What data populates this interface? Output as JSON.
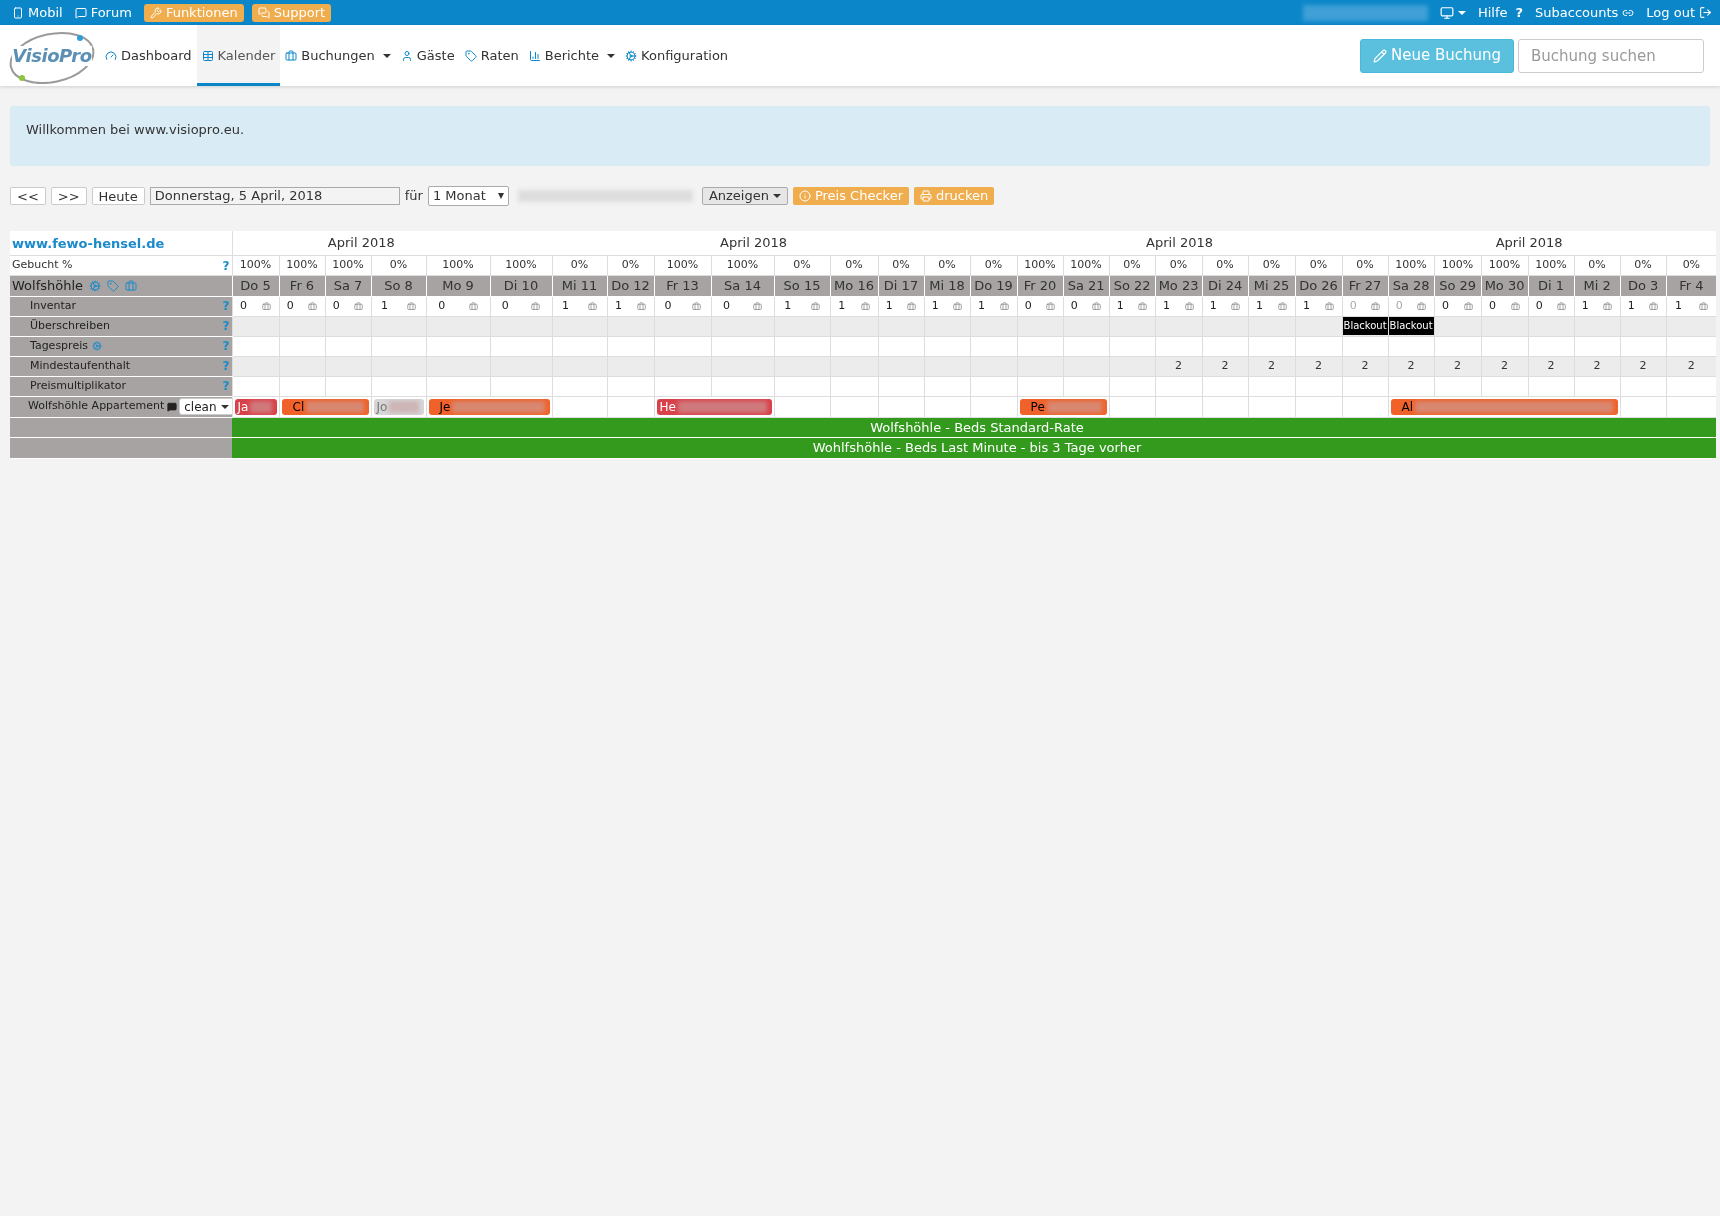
{
  "top_bar": {
    "left": [
      {
        "label": "Mobil",
        "kind": "link"
      },
      {
        "label": "Forum",
        "kind": "link"
      },
      {
        "label": "Funktionen",
        "kind": "button"
      },
      {
        "label": "Support",
        "kind": "button"
      }
    ],
    "right": [
      {
        "label": "Hilfe",
        "glyph": "?"
      },
      {
        "label": "Subaccounts"
      },
      {
        "label": "Log out"
      }
    ]
  },
  "nav": {
    "logo": "VisioPro",
    "items": [
      {
        "label": "Dashboard",
        "selected": false,
        "dropdown": false
      },
      {
        "label": "Kalender",
        "selected": true,
        "dropdown": false
      },
      {
        "label": "Buchungen",
        "selected": false,
        "dropdown": true
      },
      {
        "label": "Gäste",
        "selected": false,
        "dropdown": false
      },
      {
        "label": "Raten",
        "selected": false,
        "dropdown": false
      },
      {
        "label": "Berichte",
        "selected": false,
        "dropdown": true
      },
      {
        "label": "Konfiguration",
        "selected": false,
        "dropdown": false
      }
    ],
    "new_booking": "Neue Buchung",
    "search": {
      "placeholder": "Buchung suchen"
    }
  },
  "welcome": "Willkommen bei www.visiopro.eu.",
  "toolbar": {
    "prev": "<<",
    "next": ">>",
    "today": "Heute",
    "date": "Donnerstag, 5 April, 2018",
    "for_label": "für",
    "period": "1 Monat",
    "show": "Anzeigen",
    "price_checker": "Preis Checker",
    "print": "drucken"
  },
  "calendar": {
    "property": "www.fewo-hensel.de",
    "months": [
      "April 2018",
      "April 2018",
      "April 2018",
      "April 2018"
    ],
    "help": "?",
    "booked_label": "Gebucht %",
    "room": "Wolfshöhle",
    "rows": [
      "Inventar",
      "Überschreiben",
      "Tagespreis",
      "Mindestaufenthalt",
      "Preismultiplikator"
    ],
    "unit": {
      "name": "Wolfshöhle Appartement",
      "status": "clean"
    },
    "days": [
      {
        "label": "Do 5",
        "booked": "100%",
        "inventory": "0",
        "disabled": false,
        "booking": {
          "kind": "start",
          "label": "Ja",
          "color": "#d9414a"
        }
      },
      {
        "label": "Fr 6",
        "booked": "100%",
        "inventory": "0",
        "disabled": false,
        "booking": {
          "kind": "start",
          "label": "Cl",
          "color": "#f0622a"
        }
      },
      {
        "label": "Sa 7",
        "booked": "100%",
        "inventory": "0",
        "disabled": false,
        "booking": {
          "kind": "continue"
        }
      },
      {
        "label": "So 8",
        "booked": "0%",
        "inventory": "1",
        "disabled": false,
        "booking": {
          "kind": "start",
          "label": "Jo",
          "color": "#d6d6d6"
        }
      },
      {
        "label": "Mo 9",
        "booked": "100%",
        "inventory": "0",
        "disabled": false,
        "booking": {
          "kind": "start",
          "label": "Je",
          "color": "#f0622a"
        }
      },
      {
        "label": "Di 10",
        "booked": "100%",
        "inventory": "0",
        "disabled": false,
        "booking": {
          "kind": "continue"
        }
      },
      {
        "label": "Mi 11",
        "booked": "0%",
        "inventory": "1",
        "disabled": false,
        "booking": {
          "kind": "free"
        }
      },
      {
        "label": "Do 12",
        "booked": "0%",
        "inventory": "1",
        "disabled": false,
        "booking": {
          "kind": "free"
        }
      },
      {
        "label": "Fr 13",
        "booked": "100%",
        "inventory": "0",
        "disabled": false,
        "booking": {
          "kind": "start",
          "label": "He",
          "color": "#d9414a"
        }
      },
      {
        "label": "Sa 14",
        "booked": "100%",
        "inventory": "0",
        "disabled": false,
        "booking": {
          "kind": "continue"
        }
      },
      {
        "label": "So 15",
        "booked": "0%",
        "inventory": "1",
        "disabled": false,
        "booking": {
          "kind": "free"
        }
      },
      {
        "label": "Mo 16",
        "booked": "0%",
        "inventory": "1",
        "disabled": false,
        "booking": {
          "kind": "free"
        }
      },
      {
        "label": "Di 17",
        "booked": "0%",
        "inventory": "1",
        "disabled": false,
        "booking": {
          "kind": "free"
        }
      },
      {
        "label": "Mi 18",
        "booked": "0%",
        "inventory": "1",
        "disabled": false,
        "booking": {
          "kind": "free"
        }
      },
      {
        "label": "Do 19",
        "booked": "0%",
        "inventory": "1",
        "disabled": false,
        "booking": {
          "kind": "free"
        }
      },
      {
        "label": "Fr 20",
        "booked": "100%",
        "inventory": "0",
        "disabled": false,
        "booking": {
          "kind": "start",
          "label": "Pe",
          "color": "#f0622a"
        }
      },
      {
        "label": "Sa 21",
        "booked": "100%",
        "inventory": "0",
        "disabled": false,
        "booking": {
          "kind": "continue"
        }
      },
      {
        "label": "So 22",
        "booked": "0%",
        "inventory": "1",
        "disabled": false,
        "booking": {
          "kind": "free"
        }
      },
      {
        "label": "Mo 23",
        "booked": "0%",
        "inventory": "1",
        "disabled": false,
        "min_stay": "2",
        "booking": {
          "kind": "free"
        }
      },
      {
        "label": "Di 24",
        "booked": "0%",
        "inventory": "1",
        "disabled": false,
        "min_stay": "2",
        "booking": {
          "kind": "free"
        }
      },
      {
        "label": "Mi 25",
        "booked": "0%",
        "inventory": "1",
        "disabled": false,
        "min_stay": "2",
        "booking": {
          "kind": "free"
        }
      },
      {
        "label": "Do 26",
        "booked": "0%",
        "inventory": "1",
        "disabled": false,
        "min_stay": "2",
        "booking": {
          "kind": "free"
        }
      },
      {
        "label": "Fr 27",
        "booked": "0%",
        "inventory": "0",
        "disabled": true,
        "overwrite": "Blackout",
        "min_stay": "2",
        "booking": {
          "kind": "free"
        }
      },
      {
        "label": "Sa 28",
        "booked": "100%",
        "inventory": "0",
        "disabled": true,
        "overwrite": "Blackout",
        "min_stay": "2",
        "booking": {
          "kind": "start",
          "label": "Al",
          "color": "#f0622a"
        }
      },
      {
        "label": "So 29",
        "booked": "100%",
        "inventory": "0",
        "disabled": false,
        "min_stay": "2",
        "booking": {
          "kind": "continue"
        }
      },
      {
        "label": "Mo 30",
        "booked": "100%",
        "inventory": "0",
        "disabled": false,
        "min_stay": "2",
        "booking": {
          "kind": "continue"
        }
      },
      {
        "label": "Di 1",
        "booked": "100%",
        "inventory": "0",
        "disabled": false,
        "min_stay": "2",
        "booking": {
          "kind": "continue"
        }
      },
      {
        "label": "Mi 2",
        "booked": "0%",
        "inventory": "1",
        "disabled": false,
        "min_stay": "2",
        "booking": {
          "kind": "continue"
        }
      },
      {
        "label": "Do 3",
        "booked": "0%",
        "inventory": "1",
        "disabled": false,
        "min_stay": "2",
        "booking": {
          "kind": "free"
        }
      },
      {
        "label": "Fr 4",
        "booked": "0%",
        "inventory": "1",
        "disabled": false,
        "min_stay": "2",
        "booking": {
          "kind": "free"
        }
      }
    ],
    "rates": [
      "Wolfshöhle - Beds Standard-Rate",
      "Wohlfshöhle - Beds Last Minute - bis 3 Tage vorher"
    ]
  }
}
